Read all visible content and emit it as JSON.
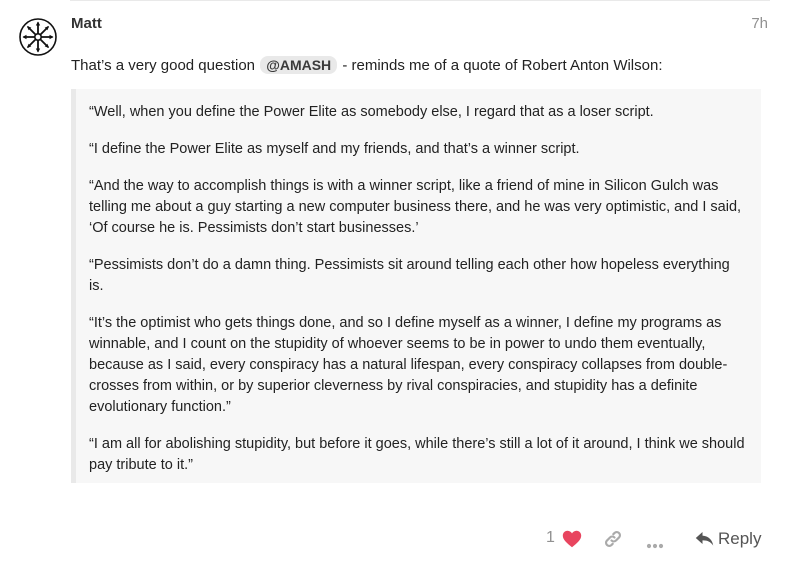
{
  "post": {
    "username": "Matt",
    "date": "7h",
    "intro_before": "That’s a very good question ",
    "mention": "@AMASH",
    "intro_after": " - reminds me of a quote of Robert Anton Wilson:"
  },
  "quote": {
    "paragraphs": [
      "“Well, when you define the Power Elite as somebody else, I regard that as a loser script.",
      "“I define the Power Elite as myself and my friends, and that’s a winner script.",
      "“And the way to accomplish things is with a winner script, like a friend of mine in Silicon Gulch was telling me about a guy starting a new computer business there, and he was very optimistic, and I said, ‘Of course he is. Pessimists don’t start businesses.’",
      "“Pessimists don’t do a damn thing. Pessimists sit around telling each other how hopeless everything is.",
      "“It’s the optimist who gets things done, and so I define myself as a winner, I define my programs as winnable, and I count on the stupidity of whoever seems to be in power to undo them eventually, because as I said, every conspiracy has a natural lifespan, every conspiracy collapses from double-crosses from within, or by superior cleverness by rival conspiracies, and stupidity has a definite evolutionary function.”",
      "“I am all for abolishing stupidity, but before it goes, while there’s still a lot of it around, I think we should pay tribute to it.”"
    ]
  },
  "actions": {
    "like_count": "1",
    "reply_label": "Reply",
    "heart_color": "#e8455f",
    "icon_color": "#aaaaaa"
  },
  "icons": {
    "avatar": "chaos-star-avatar",
    "like": "heart-icon",
    "share": "link-icon",
    "more": "ellipsis-icon",
    "reply": "reply-arrow-icon"
  }
}
